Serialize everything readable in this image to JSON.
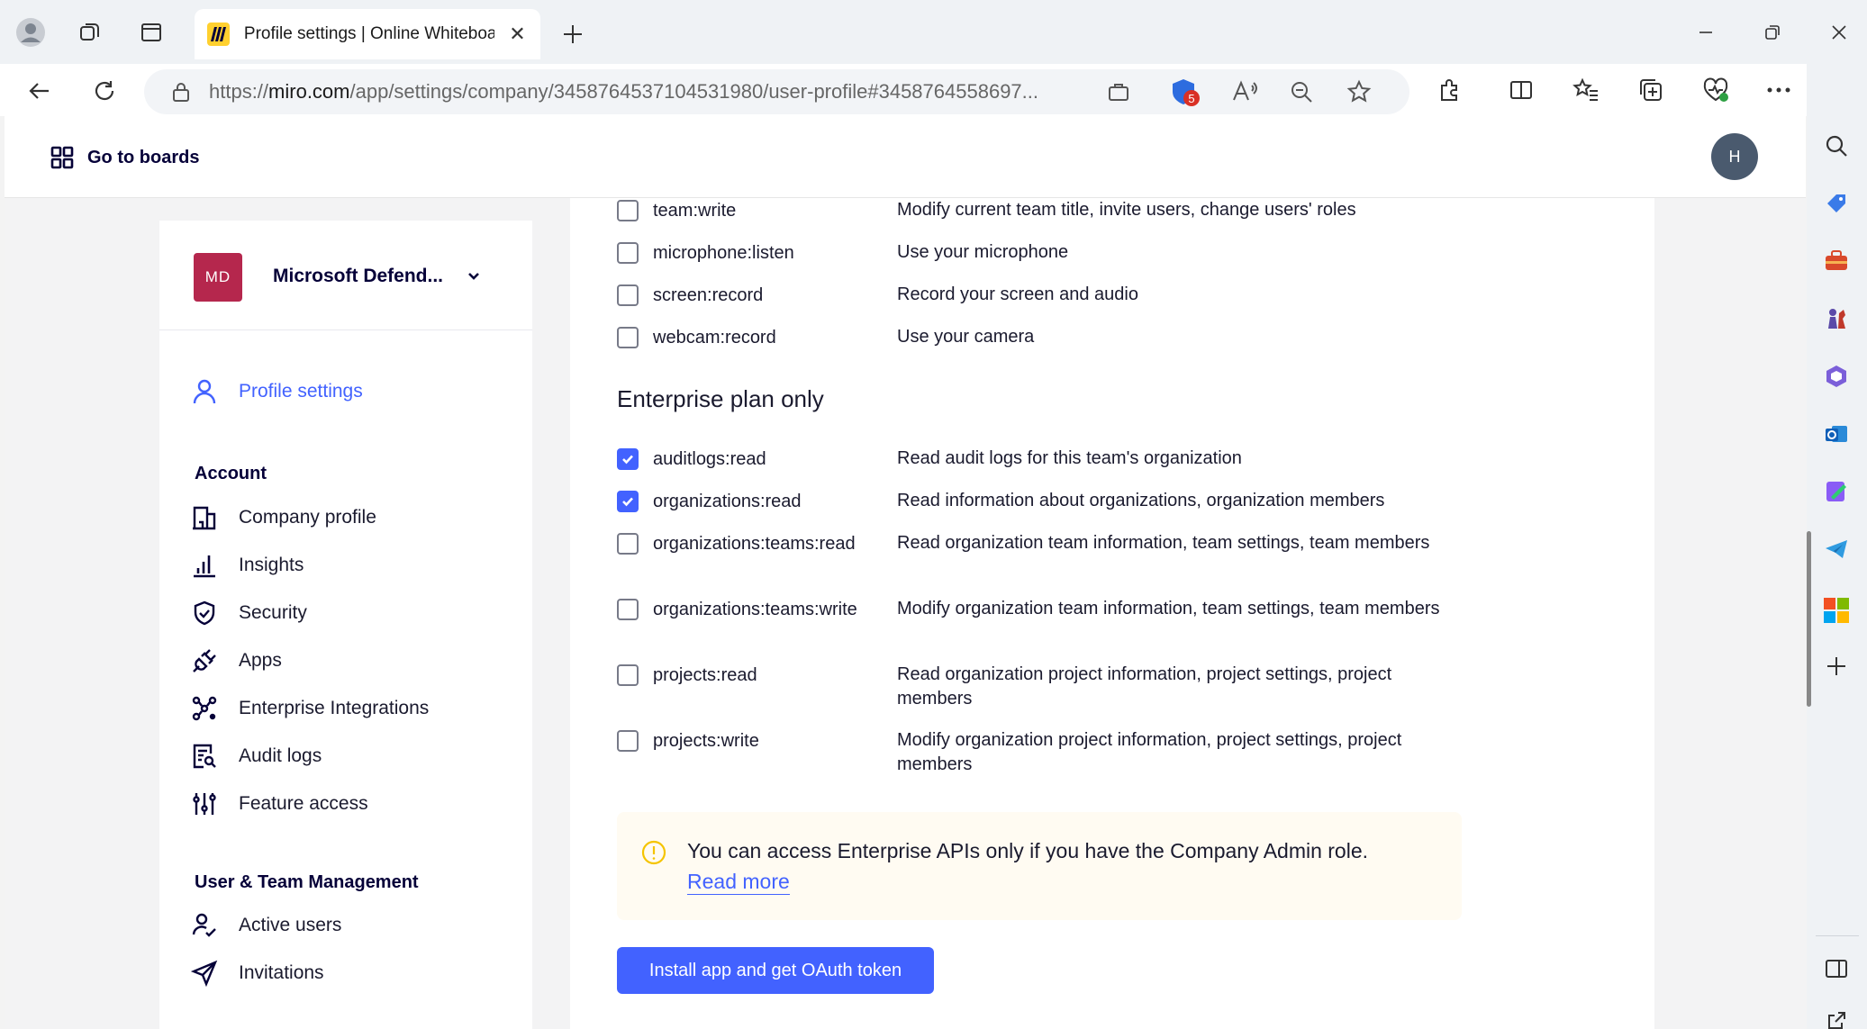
{
  "browser": {
    "tab_title": "Profile settings | Online Whiteboard",
    "new_tab_label": "+",
    "url_scheme": "https://",
    "url_host": "miro.com",
    "url_path": "/app/settings/company/3458764537104531980/user-profile#3458764558697...",
    "shield_badge_count": "5"
  },
  "header": {
    "goto_boards": "Go to boards",
    "user_avatar": "H"
  },
  "sidebar": {
    "org_initials": "MD",
    "org_name": "Microsoft Defend...",
    "profile_settings": "Profile settings",
    "account_heading": "Account",
    "account_items": [
      {
        "label": "Company profile",
        "icon": "building-icon"
      },
      {
        "label": "Insights",
        "icon": "bar-chart-icon"
      },
      {
        "label": "Security",
        "icon": "shield-check-icon"
      },
      {
        "label": "Apps",
        "icon": "plug-icon"
      },
      {
        "label": "Enterprise Integrations",
        "icon": "integrations-icon"
      },
      {
        "label": "Audit logs",
        "icon": "audit-log-icon"
      },
      {
        "label": "Feature access",
        "icon": "sliders-icon"
      }
    ],
    "team_heading": "User & Team Management",
    "team_items": [
      {
        "label": "Active users",
        "icon": "user-check-icon"
      },
      {
        "label": "Invitations",
        "icon": "send-icon"
      }
    ]
  },
  "main": {
    "permissions_top": [
      {
        "name": "team:write",
        "desc": "Modify current team title, invite users, change users' roles",
        "checked": false
      },
      {
        "name": "microphone:listen",
        "desc": "Use your microphone",
        "checked": false
      },
      {
        "name": "screen:record",
        "desc": "Record your screen and audio",
        "checked": false
      },
      {
        "name": "webcam:record",
        "desc": "Use your camera",
        "checked": false
      }
    ],
    "enterprise_heading": "Enterprise plan only",
    "permissions_enterprise": [
      {
        "name": "auditlogs:read",
        "desc": "Read audit logs for this team's organization",
        "checked": true
      },
      {
        "name": "organizations:read",
        "desc": "Read information about organizations, organization members",
        "checked": true
      },
      {
        "name": "organizations:teams:read",
        "desc": "Read organization team information, team settings, team members",
        "checked": false
      },
      {
        "name": "organizations:teams:write",
        "desc": "Modify organization team information, team settings, team members",
        "checked": false
      },
      {
        "name": "projects:read",
        "desc": "Read organization project information, project settings, project members",
        "checked": false
      },
      {
        "name": "projects:write",
        "desc": "Modify organization project information, project settings, project members",
        "checked": false
      }
    ],
    "notice_text": "You can access Enterprise APIs only if you have the Company Admin role.",
    "notice_link": "Read more",
    "install_button": "Install app and get OAuth token"
  },
  "colors": {
    "accent": "#4262ff",
    "org_badge": "#b5274d",
    "notice_bg": "#fffbf2",
    "notice_icon": "#f5c400"
  }
}
